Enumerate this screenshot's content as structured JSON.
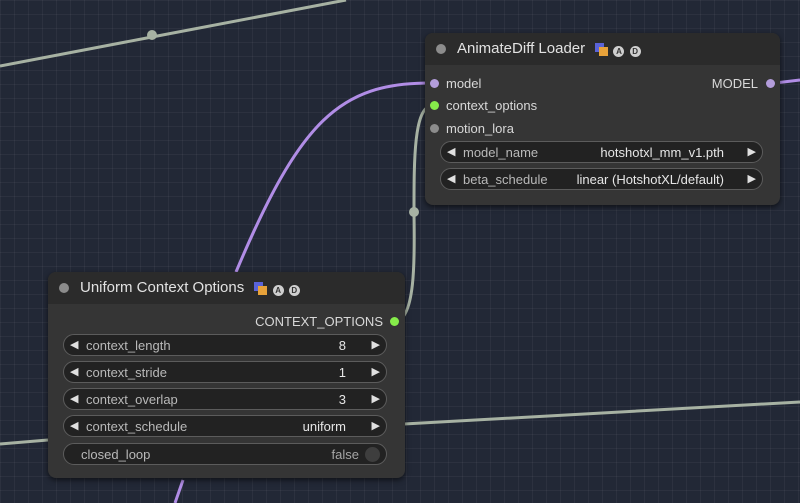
{
  "nodes": {
    "animatediff": {
      "title": "AnimateDiff Loader",
      "inputs": [
        "model",
        "context_options",
        "motion_lora"
      ],
      "output": "MODEL",
      "widgets": [
        {
          "name": "model_name",
          "value": "hotshotxl_mm_v1.pth"
        },
        {
          "name": "beta_schedule",
          "value": "linear (HotshotXL/default)"
        }
      ]
    },
    "context": {
      "title": "Uniform Context Options",
      "output": "CONTEXT_OPTIONS",
      "widgets": [
        {
          "name": "context_length",
          "value": "8"
        },
        {
          "name": "context_stride",
          "value": "1"
        },
        {
          "name": "context_overlap",
          "value": "3"
        },
        {
          "name": "context_schedule",
          "value": "uniform"
        }
      ],
      "toggle": {
        "name": "closed_loop",
        "value": "false"
      }
    }
  },
  "badges": {
    "a": "A",
    "d": "D"
  },
  "colors": {
    "canvas": "#222836",
    "node_body": "#353535",
    "node_title": "#2b2b2b",
    "model_wire": "#b18de6",
    "context_wire": "#a7b2a3",
    "context_slot": "#86ec4a",
    "model_slot": "#b39ddb"
  }
}
